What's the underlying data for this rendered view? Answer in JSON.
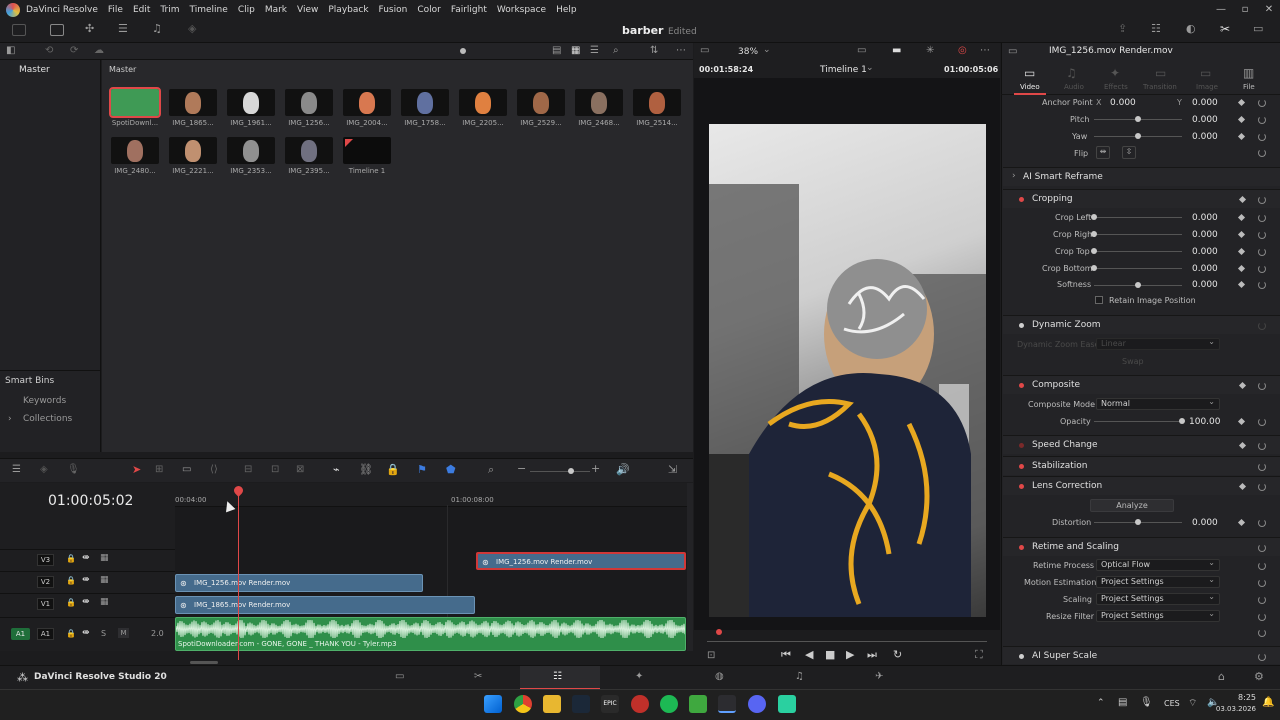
{
  "menu": {
    "app": "DaVinci Resolve",
    "items": [
      "File",
      "Edit",
      "Trim",
      "Timeline",
      "Clip",
      "Mark",
      "View",
      "Playback",
      "Fusion",
      "Color",
      "Fairlight",
      "Workspace",
      "Help"
    ]
  },
  "project": {
    "title": "barber",
    "status": "Edited"
  },
  "zoom": "38%",
  "bins": {
    "master": "Master",
    "smart_bins": "Smart Bins",
    "items": [
      "Keywords",
      "Collections"
    ],
    "pool_title": "Master"
  },
  "clips": [
    {
      "label": "SpotiDownl...",
      "kind": "audio"
    },
    {
      "label": "IMG_1865...",
      "kind": "video"
    },
    {
      "label": "IMG_1961...",
      "kind": "video"
    },
    {
      "label": "IMG_1256...",
      "kind": "video"
    },
    {
      "label": "IMG_2004...",
      "kind": "video"
    },
    {
      "label": "IMG_1758...",
      "kind": "video"
    },
    {
      "label": "IMG_2205...",
      "kind": "video"
    },
    {
      "label": "IMG_2529...",
      "kind": "video"
    },
    {
      "label": "IMG_2468...",
      "kind": "video"
    },
    {
      "label": "IMG_2514...",
      "kind": "video"
    },
    {
      "label": "IMG_2480...",
      "kind": "video"
    },
    {
      "label": "IMG_2221...",
      "kind": "video"
    },
    {
      "label": "IMG_2353...",
      "kind": "video"
    },
    {
      "label": "IMG_2395...",
      "kind": "video"
    },
    {
      "label": "Timeline 1",
      "kind": "timeline"
    }
  ],
  "viewer": {
    "source_tc": "00:01:58:24",
    "timeline_name": "Timeline 1",
    "record_tc": "01:00:05:06"
  },
  "inspector": {
    "clip_title": "IMG_1256.mov Render.mov",
    "tabs": [
      "Video",
      "Audio",
      "Effects",
      "Transition",
      "Image",
      "File"
    ],
    "anchor": {
      "label": "Anchor Point",
      "x_label": "X",
      "x": "0.000",
      "y_label": "Y",
      "y": "0.000"
    },
    "pitch": {
      "label": "Pitch",
      "value": "0.000"
    },
    "yaw": {
      "label": "Yaw",
      "value": "0.000"
    },
    "flip": {
      "label": "Flip"
    },
    "ai_reframe": "AI Smart Reframe",
    "cropping": {
      "title": "Cropping",
      "left": {
        "label": "Crop Left",
        "value": "0.000"
      },
      "right": {
        "label": "Crop Right",
        "value": "0.000"
      },
      "top": {
        "label": "Crop Top",
        "value": "0.000"
      },
      "bottom": {
        "label": "Crop Bottom",
        "value": "0.000"
      },
      "softness": {
        "label": "Softness",
        "value": "0.000"
      },
      "retain": "Retain Image Position"
    },
    "dynamic_zoom": {
      "title": "Dynamic Zoom",
      "ease_label": "Dynamic Zoom Ease",
      "ease_value": "Linear",
      "swap": "Swap"
    },
    "composite": {
      "title": "Composite",
      "mode_label": "Composite Mode",
      "mode": "Normal",
      "opacity_label": "Opacity",
      "opacity": "100.00"
    },
    "speed_change": "Speed Change",
    "stabilization": "Stabilization",
    "lens": {
      "title": "Lens Correction",
      "analyze": "Analyze",
      "distortion_label": "Distortion",
      "distortion": "0.000"
    },
    "retime": {
      "title": "Retime and Scaling",
      "process_label": "Retime Process",
      "process": "Optical Flow",
      "motion_label": "Motion Estimation",
      "motion": "Project Settings",
      "scaling_label": "Scaling",
      "scaling": "Project Settings",
      "filter_label": "Resize Filter",
      "filter": "Project Settings"
    },
    "super_scale": "AI Super Scale"
  },
  "timeline": {
    "timecode": "01:00:05:02",
    "ruler_marks": [
      "00:04:00",
      "01:00:08:00"
    ],
    "tracks": [
      {
        "id": "V3",
        "clip": "IMG_1256.mov Render.mov"
      },
      {
        "id": "V2",
        "clip": "IMG_1256.mov Render.mov"
      },
      {
        "id": "V1",
        "clip": "IMG_1865.mov Render.mov"
      }
    ],
    "audio": {
      "id": "A1",
      "src": "A1",
      "level": "2.0",
      "solo": "S",
      "mute": "M",
      "clip": "SpotiDownloader.com - GONE, GONE _ THANK YOU - Tyler.mp3"
    }
  },
  "footer": {
    "app_name": "DaVinci Resolve Studio 20"
  },
  "taskbar": {
    "lang": "CES",
    "time": "8:25",
    "date": "03.03.2026"
  }
}
